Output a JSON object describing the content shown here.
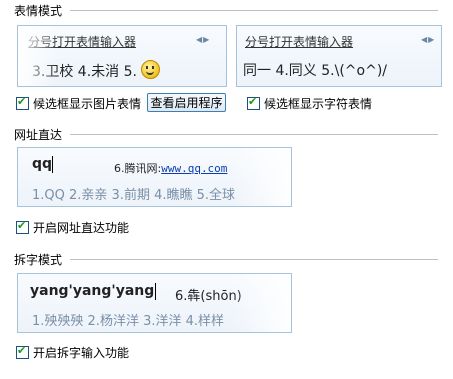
{
  "emoji_section": {
    "title": "表情模式",
    "left_preview": {
      "header": "分号打开表情输入器",
      "candidates": "3.卫校  4.未消  5.",
      "leading_fragment": "l"
    },
    "right_preview": {
      "header": "分号打开表情输入器",
      "candidates": "同一  4.同义  5.\\(^o^)/"
    },
    "show_image_emoji_label": "候选框显示图片表情",
    "view_apps_button": "查看启用程序",
    "show_char_emoji_label": "候选框显示字符表情"
  },
  "url_section": {
    "title": "网址直达",
    "input": "qq",
    "hint_prefix": "6.腾讯网:",
    "hint_link": "www.qq.com",
    "candidates": "1.QQ  2.亲亲  3.前期  4.瞧瞧  5.全球",
    "enable_label": "开启网址直达功能"
  },
  "split_section": {
    "title": "拆字模式",
    "input": "yang'yang'yang",
    "hint": "6.犇(shōn)",
    "candidates": "1.殃殃殃  2.杨洋洋  3.洋洋  4.样样",
    "enable_label": "开启拆字输入功能"
  }
}
